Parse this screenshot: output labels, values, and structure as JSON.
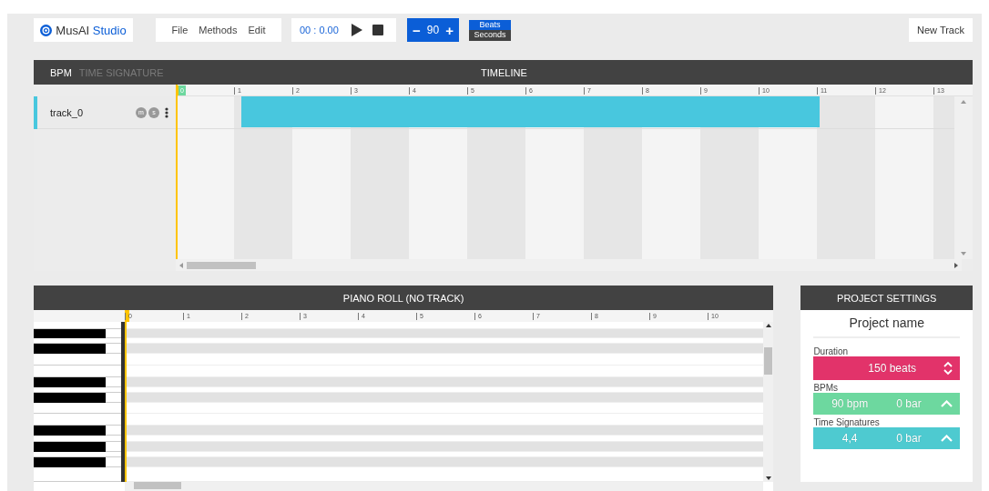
{
  "app": {
    "logo_prefix": "MusAI",
    "logo_suffix": "Studio"
  },
  "menu": [
    "File",
    "Methods",
    "Edit"
  ],
  "transport": {
    "time": "00 : 0.00"
  },
  "tempo": {
    "minus": "−",
    "value": "90",
    "plus": "+"
  },
  "time_mode": [
    {
      "label": "Beats",
      "selected": true
    },
    {
      "label": "Seconds",
      "selected": false
    }
  ],
  "new_track": "New Track",
  "timeline": {
    "tabs": [
      {
        "label": "BPM",
        "selected": true
      },
      {
        "label": "TIME SIGNATURE",
        "selected": false
      }
    ],
    "title": "TIMELINE",
    "ruler": [
      "0",
      "1",
      "2",
      "3",
      "4",
      "5",
      "6",
      "7",
      "8",
      "9",
      "10",
      "11",
      "12",
      "13"
    ],
    "tracks": [
      {
        "name": "track_0",
        "color": "#48c7de",
        "mute": "m",
        "solo": "s"
      }
    ]
  },
  "piano_roll": {
    "title": "PIANO ROLL (NO TRACK)",
    "ruler": [
      "0",
      "1",
      "2",
      "3",
      "4",
      "5",
      "6",
      "7",
      "8",
      "9",
      "10"
    ]
  },
  "project_settings": {
    "title": "PROJECT SETTINGS",
    "name": "Project name",
    "fields": [
      {
        "label": "Duration",
        "kind": "spinner",
        "value": "150 beats",
        "color": "#e2336a"
      },
      {
        "label": "BPMs",
        "kind": "list",
        "value": "90 bpm",
        "extra": "0 bar",
        "color": "#6dd89f"
      },
      {
        "label": "Time Signatures",
        "kind": "list",
        "value": "4,4",
        "extra": "0 bar",
        "color": "#4ecad0"
      }
    ]
  }
}
